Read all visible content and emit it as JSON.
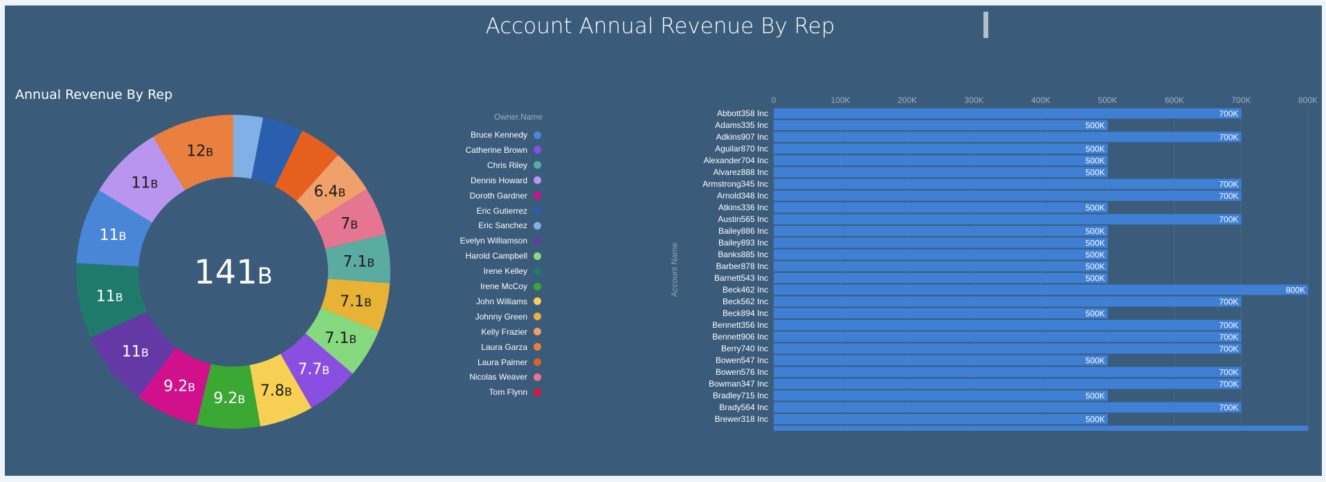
{
  "dashboard": {
    "title": "Account Annual Revenue By Rep"
  },
  "colors": {
    "panel_bg": "#3a5b79",
    "bar": "#3f7fd4"
  },
  "chart_data": [
    {
      "type": "pie",
      "variant": "donut",
      "title": "Annual Revenue By Rep",
      "center_label": "141",
      "center_unit": "B",
      "legend_title": "Owner.Name",
      "legend_position": "right",
      "unit": "B",
      "legend": [
        {
          "name": "Bruce Kennedy",
          "color": "#4a86d8"
        },
        {
          "name": "Catherine Brown",
          "color": "#8a4fe0"
        },
        {
          "name": "Chris Riley",
          "color": "#5aaba0"
        },
        {
          "name": "Dennis Howard",
          "color": "#b995f0"
        },
        {
          "name": "Doroth Gardner",
          "color": "#d1108c"
        },
        {
          "name": "Eric Gutierrez",
          "color": "#2a5fb0"
        },
        {
          "name": "Eric Sanchez",
          "color": "#80b0e6"
        },
        {
          "name": "Evelyn Williamson",
          "color": "#6439a6"
        },
        {
          "name": "Harold Campbell",
          "color": "#86d97f"
        },
        {
          "name": "Irene Kelley",
          "color": "#1f7a6c"
        },
        {
          "name": "Irene McCoy",
          "color": "#3aa832"
        },
        {
          "name": "John Williams",
          "color": "#f8d154"
        },
        {
          "name": "Johnny Green",
          "color": "#e8b235"
        },
        {
          "name": "Kelly Frazier",
          "color": "#f0a06a"
        },
        {
          "name": "Laura Garza",
          "color": "#e98040"
        },
        {
          "name": "Laura Palmer",
          "color": "#e5601f"
        },
        {
          "name": "Nicolas Weaver",
          "color": "#e57590"
        },
        {
          "name": "Tom Flynn",
          "color": "#e0103f"
        }
      ],
      "slices": [
        {
          "name": "Eric Sanchez",
          "value": 4.3,
          "label": null,
          "color": "#80b0e6",
          "dark_text": true
        },
        {
          "name": "Eric Gutierrez",
          "value": 5.9,
          "label": null,
          "color": "#2a5fb0",
          "dark_text": false
        },
        {
          "name": "Laura Palmer",
          "value": 6.2,
          "label": null,
          "color": "#e5601f",
          "dark_text": false
        },
        {
          "name": "Kelly Frazier",
          "value": 6.4,
          "label": "6.4",
          "color": "#f0a06a",
          "dark_text": true
        },
        {
          "name": "Nicolas Weaver",
          "value": 7,
          "label": "7",
          "color": "#e57590",
          "dark_text": true
        },
        {
          "name": "Chris Riley",
          "value": 7.1,
          "label": "7.1",
          "color": "#5aaba0",
          "dark_text": true
        },
        {
          "name": "Johnny Green",
          "value": 7.1,
          "label": "7.1",
          "color": "#e8b235",
          "dark_text": true
        },
        {
          "name": "Harold Campbell",
          "value": 7.1,
          "label": "7.1",
          "color": "#86d97f",
          "dark_text": true
        },
        {
          "name": "Catherine Brown",
          "value": 7.7,
          "label": "7.7",
          "color": "#8a4fe0",
          "dark_text": false
        },
        {
          "name": "John Williams",
          "value": 7.8,
          "label": "7.8",
          "color": "#f8d154",
          "dark_text": true
        },
        {
          "name": "Irene McCoy",
          "value": 9.2,
          "label": "9.2",
          "color": "#3aa832",
          "dark_text": false
        },
        {
          "name": "Doroth Gardner",
          "value": 9.2,
          "label": "9.2",
          "color": "#d1108c",
          "dark_text": false
        },
        {
          "name": "Evelyn Williamson",
          "value": 11,
          "label": "11",
          "color": "#6439a6",
          "dark_text": false
        },
        {
          "name": "Irene Kelley",
          "value": 11,
          "label": "11",
          "color": "#1f7a6c",
          "dark_text": false
        },
        {
          "name": "Bruce Kennedy",
          "value": 11,
          "label": "11",
          "color": "#4a86d8",
          "dark_text": false
        },
        {
          "name": "Dennis Howard",
          "value": 11,
          "label": "11",
          "color": "#b995f0",
          "dark_text": true
        },
        {
          "name": "Laura Garza",
          "value": 12,
          "label": "12",
          "color": "#e98040",
          "dark_text": true
        }
      ]
    },
    {
      "type": "bar",
      "orientation": "horizontal",
      "ylabel": "Account Name",
      "xlim": [
        0,
        800000
      ],
      "x_ticks": [
        "0",
        "100K",
        "200K",
        "300K",
        "400K",
        "500K",
        "600K",
        "700K",
        "800K"
      ],
      "x_axis_position": "top",
      "grid": true,
      "categories": [
        "Abbott358 Inc",
        "Adams335 Inc",
        "Adkins907 Inc",
        "Aguilar870 Inc",
        "Alexander704 Inc",
        "Alvarez888 Inc",
        "Armstrong345 Inc",
        "Arnold348 Inc",
        "Atkins336 Inc",
        "Austin565 Inc",
        "Bailey886 Inc",
        "Bailey893 Inc",
        "Banks885 Inc",
        "Barber878 Inc",
        "Barnett543 Inc",
        "Beck462 Inc",
        "Beck562 Inc",
        "Beck894 Inc",
        "Bennett356 Inc",
        "Bennett906 Inc",
        "Berry740 Inc",
        "Bowen547 Inc",
        "Bowen576 Inc",
        "Bowman347 Inc",
        "Bradley715 Inc",
        "Brady564 Inc",
        "Brewer318 Inc",
        ""
      ],
      "values": [
        700000,
        500000,
        700000,
        500000,
        500000,
        500000,
        700000,
        700000,
        500000,
        700000,
        500000,
        500000,
        500000,
        500000,
        500000,
        800000,
        700000,
        500000,
        700000,
        700000,
        700000,
        500000,
        700000,
        700000,
        500000,
        700000,
        500000,
        800000
      ],
      "value_labels": [
        "700K",
        "500K",
        "700K",
        "500K",
        "500K",
        "500K",
        "700K",
        "700K",
        "500K",
        "700K",
        "500K",
        "500K",
        "500K",
        "500K",
        "500K",
        "800K",
        "700K",
        "500K",
        "700K",
        "700K",
        "700K",
        "500K",
        "700K",
        "700K",
        "500K",
        "700K",
        "500K",
        ""
      ]
    }
  ]
}
